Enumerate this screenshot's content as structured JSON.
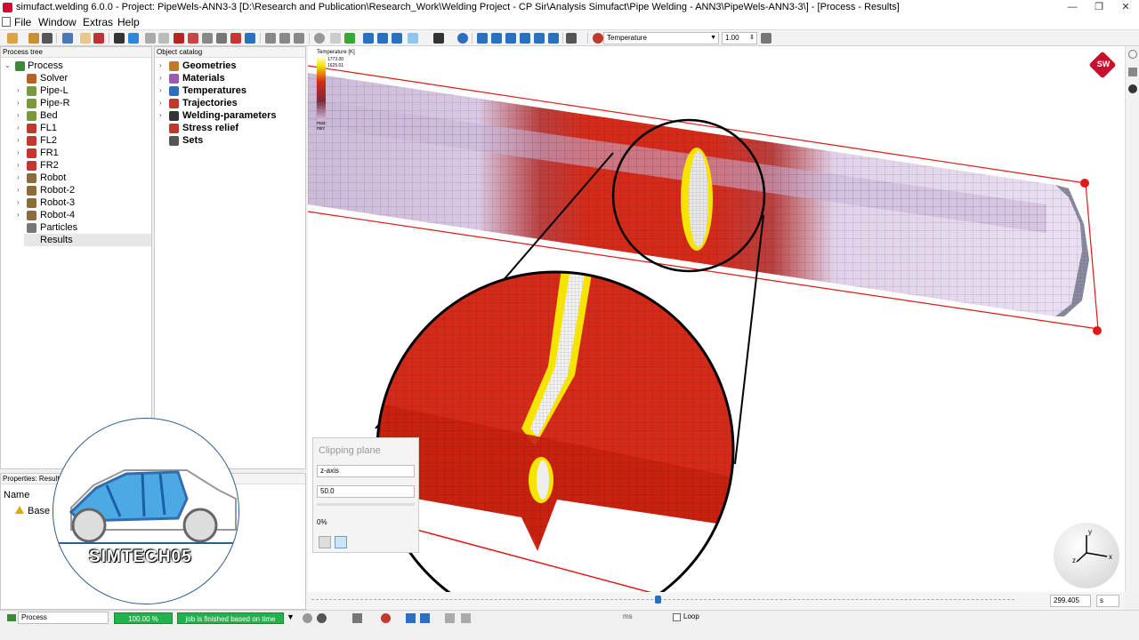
{
  "window": {
    "title": "simufact.welding 6.0.0 - Project: PipeWels-ANN3-3 [D:\\Research and Publication\\Research_Work\\Welding Project - CP Sir\\Analysis Simufact\\Pipe Welding - ANN3\\PipeWels-ANN3-3\\]  - [Process - Results]",
    "controls": {
      "minimize": "—",
      "restore": "❐",
      "close": "✕"
    }
  },
  "menu": [
    "File",
    "Window",
    "Extras",
    "Help"
  ],
  "toolbar": {
    "result_select": "Temperature",
    "scale_value": "1.00"
  },
  "process_tree": {
    "header": "Process tree",
    "root": "Process",
    "items": [
      {
        "label": "Solver",
        "expandable": false,
        "color": "#b5651d"
      },
      {
        "label": "Pipe-L",
        "expandable": true,
        "color": "#7a9a3a"
      },
      {
        "label": "Pipe-R",
        "expandable": true,
        "color": "#7a9a3a"
      },
      {
        "label": "Bed",
        "expandable": true,
        "color": "#7a9a3a"
      },
      {
        "label": "FL1",
        "expandable": true,
        "color": "#c0392b"
      },
      {
        "label": "FL2",
        "expandable": true,
        "color": "#c0392b"
      },
      {
        "label": "FR1",
        "expandable": true,
        "color": "#c0392b"
      },
      {
        "label": "FR2",
        "expandable": true,
        "color": "#c0392b"
      },
      {
        "label": "Robot",
        "expandable": true,
        "color": "#8e6c3a"
      },
      {
        "label": "Robot-2",
        "expandable": true,
        "color": "#8e6c3a"
      },
      {
        "label": "Robot-3",
        "expandable": true,
        "color": "#8e6c3a"
      },
      {
        "label": "Robot-4",
        "expandable": true,
        "color": "#8e6c3a"
      },
      {
        "label": "Particles",
        "expandable": false,
        "color": "#777777"
      },
      {
        "label": "Results",
        "expandable": false,
        "color": "#4a7ab5"
      }
    ]
  },
  "object_catalog": {
    "header": "Object catalog",
    "items": [
      {
        "label": "Geometries",
        "color": "#c07a2a"
      },
      {
        "label": "Materials",
        "color": "#9b59b6"
      },
      {
        "label": "Temperatures",
        "color": "#2a6fc0"
      },
      {
        "label": "Trajectories",
        "color": "#c0392b"
      },
      {
        "label": "Welding-parameters",
        "color": "#333333"
      },
      {
        "label": "Stress relief",
        "color": "#c0392b"
      },
      {
        "label": "Sets",
        "color": "#555555"
      }
    ]
  },
  "properties": {
    "header": "Properties: Results",
    "col_name": "Name",
    "row1": "Base p"
  },
  "clipping": {
    "title": "Clipping plane",
    "axis": "z-axis",
    "value": "50.0",
    "percent": "0%"
  },
  "legend": {
    "title": "Temperature [K]",
    "top_value": "1773.00",
    "second_value": "1625.01",
    "max_label": "max:",
    "min_label": "min:"
  },
  "watermark": "SIMTECH05",
  "timeline": {
    "time_value": "299.405",
    "unit": "s",
    "unit_small": "ms",
    "loop": "Loop"
  },
  "status": {
    "process_select": "Process",
    "progress": "100.00 %",
    "message": "job is finished based on time"
  },
  "axes": {
    "x": "x",
    "y": "y",
    "z": "z"
  },
  "logo": "SW",
  "colors": {
    "hot_red": "#d42a1a",
    "weld_yellow": "#f5e400",
    "pipe_lavender": "#e3d8ef",
    "progress_green": "#22b14c"
  }
}
